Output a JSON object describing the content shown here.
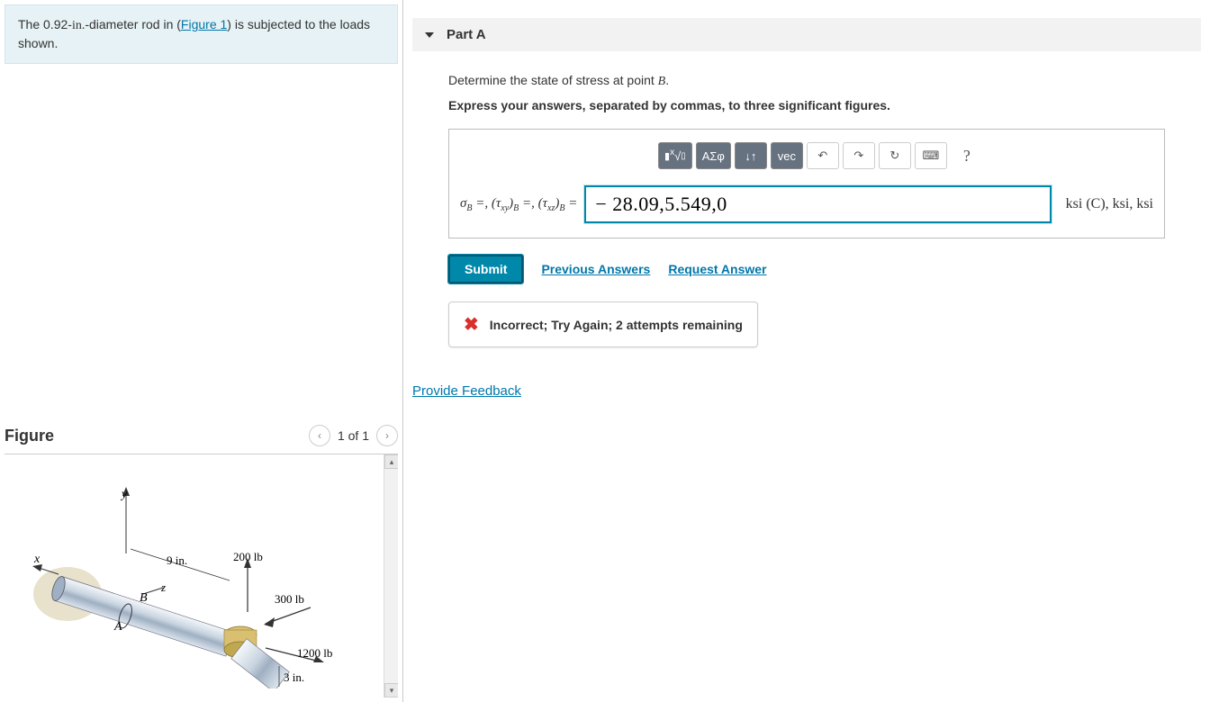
{
  "left": {
    "problem_text_prefix": "The 0.92-",
    "problem_unit": "in.",
    "problem_text_mid": "-diameter rod in (",
    "figure_link": "Figure 1",
    "problem_text_suffix": ") is subjected to the loads shown.",
    "figure_title": "Figure",
    "figure_page": "1 of 1",
    "diagram": {
      "label_9in": "9 in.",
      "label_200lb": "200 lb",
      "label_300lb": "300 lb",
      "label_1200lb": "1200 lb",
      "label_3in": "3 in.",
      "axis_x": "x",
      "axis_y": "y",
      "axis_z": "z",
      "point_A": "A",
      "point_B": "B"
    }
  },
  "right": {
    "part_label": "Part A",
    "instruction_prefix": "Determine the state of stress at point ",
    "instruction_point": "B",
    "instruction_suffix": ".",
    "bold_instruction": "Express your answers, separated by commas, to three significant figures.",
    "toolbar": {
      "templates": "■√□",
      "greek": "ΑΣφ",
      "subsup": "↓↑",
      "vec": "vec",
      "undo": "↶",
      "redo": "↷",
      "reset": "↻",
      "keyboard": "⌨",
      "help": "?"
    },
    "lhs_html": "σ_B =, (τ_xy)_B =, (τ_xz)_B =",
    "answer_value": "− 28.09,5.549,0",
    "units": "ksi (C), ksi, ksi",
    "submit": "Submit",
    "prev_answers": "Previous Answers",
    "request_answer": "Request Answer",
    "feedback": "Incorrect; Try Again; 2 attempts remaining",
    "provide_feedback": "Provide Feedback"
  }
}
